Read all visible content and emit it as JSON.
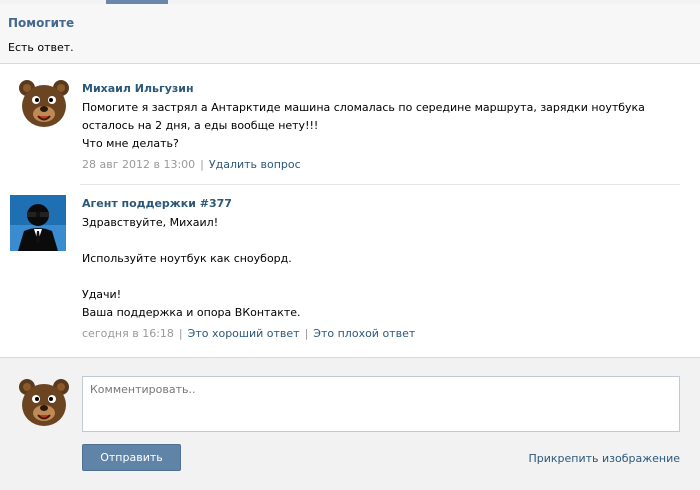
{
  "colors": {
    "accent": "#45688e",
    "link": "#2b587a",
    "button": "#6083a8",
    "meta": "#999999"
  },
  "header": {
    "title": "Помогите",
    "subtitle": "Есть ответ."
  },
  "question": {
    "author": "Михаил Ильгузин",
    "avatar_icon": "bear-avatar-icon",
    "lines": [
      "Помогите я застрял а Антарктиде машина сломалась по середине маршрута, зарядки ноутбука",
      "осталось на 2 дня, а еды вообще нету!!!",
      "Что мне делать?"
    ],
    "date": "28 авг 2012 в 13:00",
    "action": "Удалить вопрос"
  },
  "answer": {
    "author": "Агент поддержки #377",
    "avatar_icon": "agent-avatar-icon",
    "greeting": "Здравствуйте, Михаил!",
    "advice": "Используйте ноутбук как сноуборд.",
    "closing1": "Удачи!",
    "closing2": "Ваша поддержка и опора ВКонтакте.",
    "date": "сегодня в 16:18",
    "good": "Это хороший ответ",
    "bad": "Это плохой ответ"
  },
  "comment": {
    "avatar_icon": "bear-avatar-icon",
    "placeholder": "Комментировать..",
    "send_label": "Отправить",
    "attach_label": "Прикрепить изображение"
  }
}
